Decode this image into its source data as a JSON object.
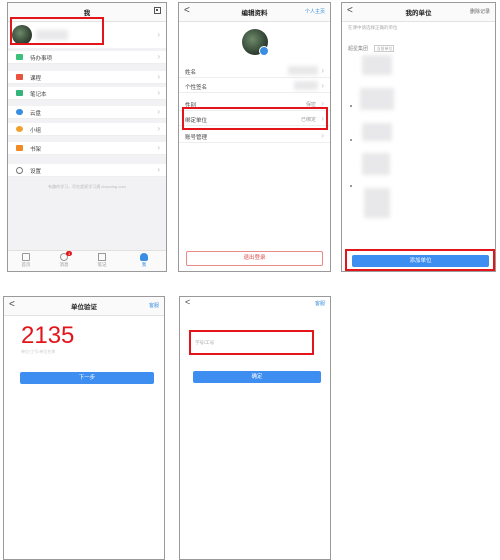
{
  "screen1": {
    "title": "我",
    "menu": [
      {
        "label": "待办事项",
        "color": "#3cc07a"
      },
      {
        "label": "课程",
        "color": "#e8523f"
      },
      {
        "label": "笔记本",
        "color": "#34b47a"
      },
      {
        "label": "云盘",
        "color": "#3a8de0"
      },
      {
        "label": "小组",
        "color": "#f0a12c"
      },
      {
        "label": "书架",
        "color": "#f08a24"
      },
      {
        "label": "设置",
        "color": "#888888"
      }
    ],
    "footer": "有趣的学习，尽在超星学习通 chaoxing.com",
    "tabs": [
      {
        "label": "首页",
        "active": false
      },
      {
        "label": "消息",
        "active": false,
        "badge": "1"
      },
      {
        "label": "笔记",
        "active": false
      },
      {
        "label": "我",
        "active": true
      }
    ]
  },
  "screen2": {
    "back": "<",
    "title": "编辑资料",
    "right": "个人主页",
    "rows": [
      {
        "label": "姓名",
        "value": ""
      },
      {
        "label": "个性签名",
        "value": ""
      },
      {
        "label": "性别",
        "value": "保密"
      },
      {
        "label": "绑定单位",
        "value": "已绑定"
      },
      {
        "label": "账号管理",
        "value": ""
      }
    ],
    "logout": "退出登录"
  },
  "screen3": {
    "back": "<",
    "title": "我的单位",
    "right": "删除记录",
    "hint": "在课中请选择正确的单位",
    "unit_label": "超星集团",
    "unit_tag": "当前单位",
    "add_button": "添加单位"
  },
  "screen4": {
    "back": "<",
    "title": "单位验证",
    "right": "客服",
    "code": "2135",
    "placeholder": "单位/工号/单位名称",
    "next": "下一步"
  },
  "screen5": {
    "back": "<",
    "right": "客服",
    "placeholder": "学号/工号",
    "confirm": "确定"
  }
}
